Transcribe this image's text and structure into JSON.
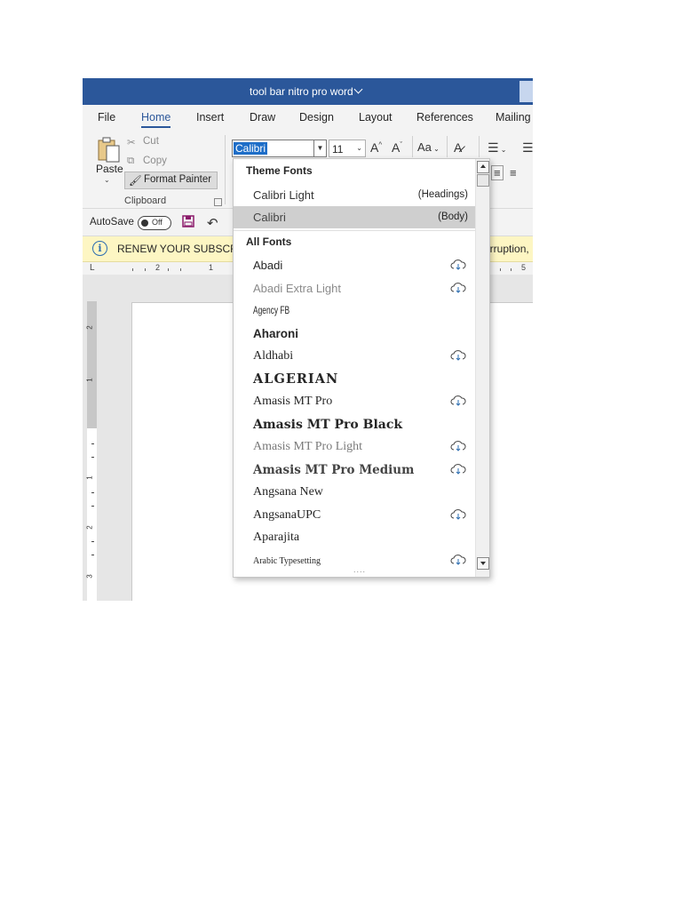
{
  "window": {
    "title": "tool bar nitro pro word"
  },
  "tabs": [
    {
      "label": "File"
    },
    {
      "label": "Home"
    },
    {
      "label": "Insert"
    },
    {
      "label": "Draw"
    },
    {
      "label": "Design"
    },
    {
      "label": "Layout"
    },
    {
      "label": "References"
    },
    {
      "label": "Mailing"
    }
  ],
  "clipboard": {
    "paste": "Paste",
    "cut": "Cut",
    "copy": "Copy",
    "format_painter": "Format Painter",
    "group_label": "Clipboard"
  },
  "font": {
    "name": "Calibri",
    "size": "11",
    "change_case": "Aa"
  },
  "qat": {
    "autosave": "AutoSave",
    "toggle": "Off"
  },
  "message": {
    "text": "RENEW YOUR SUBSCRIPT",
    "tail": "erruption,"
  },
  "ruler": {
    "h_numbers": [
      "2",
      "1",
      "5"
    ],
    "v_numbers": [
      "2",
      "1",
      "1",
      "2",
      "3"
    ]
  },
  "font_dropdown": {
    "theme_header": "Theme Fonts",
    "theme_fonts": [
      {
        "name": "Calibri Light",
        "tag": "(Headings)"
      },
      {
        "name": "Calibri",
        "tag": "(Body)"
      }
    ],
    "all_header": "All Fonts",
    "all_fonts": [
      {
        "name": "Abadi"
      },
      {
        "name": "Abadi Extra Light"
      },
      {
        "name": "Agency FB"
      },
      {
        "name": "Aharoni"
      },
      {
        "name": "Aldhabi"
      },
      {
        "name": "ALGERIAN"
      },
      {
        "name": "Amasis MT Pro"
      },
      {
        "name": "Amasis MT Pro Black"
      },
      {
        "name": "Amasis MT Pro Light"
      },
      {
        "name": "Amasis MT Pro Medium"
      },
      {
        "name": "Angsana New"
      },
      {
        "name": "AngsanaUPC"
      },
      {
        "name": "Aparajita"
      },
      {
        "name": "Arabic Typesetting"
      }
    ]
  }
}
